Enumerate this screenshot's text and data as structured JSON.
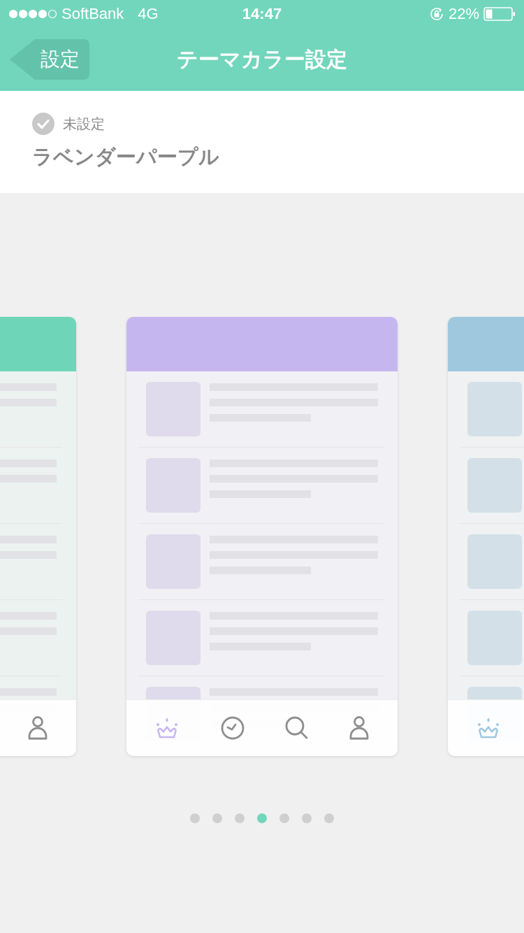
{
  "status_bar": {
    "carrier": "SoftBank",
    "network": "4G",
    "time": "14:47",
    "battery": "22%"
  },
  "nav": {
    "back": "設定",
    "title": "テーマカラー設定"
  },
  "theme_info": {
    "status": "未設定",
    "checked": false,
    "name": "ラベンダーパープル"
  },
  "themes": [
    {
      "color": "#6fd5b8"
    },
    {
      "color": "#c6b6f0"
    },
    {
      "color": "#9fc8df"
    }
  ],
  "page_dots": [
    {
      "selected": false
    },
    {
      "selected": false
    },
    {
      "selected": false
    },
    {
      "selected": true
    },
    {
      "selected": false
    },
    {
      "selected": false
    },
    {
      "selected": false
    }
  ]
}
